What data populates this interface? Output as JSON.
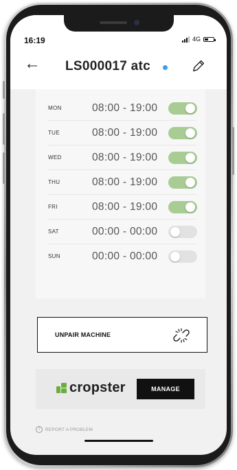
{
  "status_bar": {
    "time": "16:19",
    "network": "4G"
  },
  "header": {
    "back_icon": "arrow-left-icon",
    "title": "LS000017 atc",
    "status_dot_color": "#3d9bf0",
    "edit_icon": "pencil-icon"
  },
  "schedule": {
    "days": [
      {
        "day": "MON",
        "time": "08:00 - 19:00",
        "enabled": true
      },
      {
        "day": "TUE",
        "time": "08:00 - 19:00",
        "enabled": true
      },
      {
        "day": "WED",
        "time": "08:00 - 19:00",
        "enabled": true
      },
      {
        "day": "THU",
        "time": "08:00 - 19:00",
        "enabled": true
      },
      {
        "day": "FRI",
        "time": "08:00 - 19:00",
        "enabled": true
      },
      {
        "day": "SAT",
        "time": "00:00 - 00:00",
        "enabled": false
      },
      {
        "day": "SUN",
        "time": "00:00 - 00:00",
        "enabled": false
      }
    ],
    "toggle_on_color": "#a8cc94",
    "toggle_off_color": "#e2e2e2"
  },
  "unpair": {
    "label": "UNPAIR MACHINE",
    "icon": "unlink-icon"
  },
  "cropster": {
    "logo_text": "cropster",
    "logo_color": "#6cae3e",
    "manage_label": "MANAGE"
  },
  "footer": {
    "report_label": "REPORT A PROBLEM",
    "report_icon": "question-circle-icon"
  }
}
